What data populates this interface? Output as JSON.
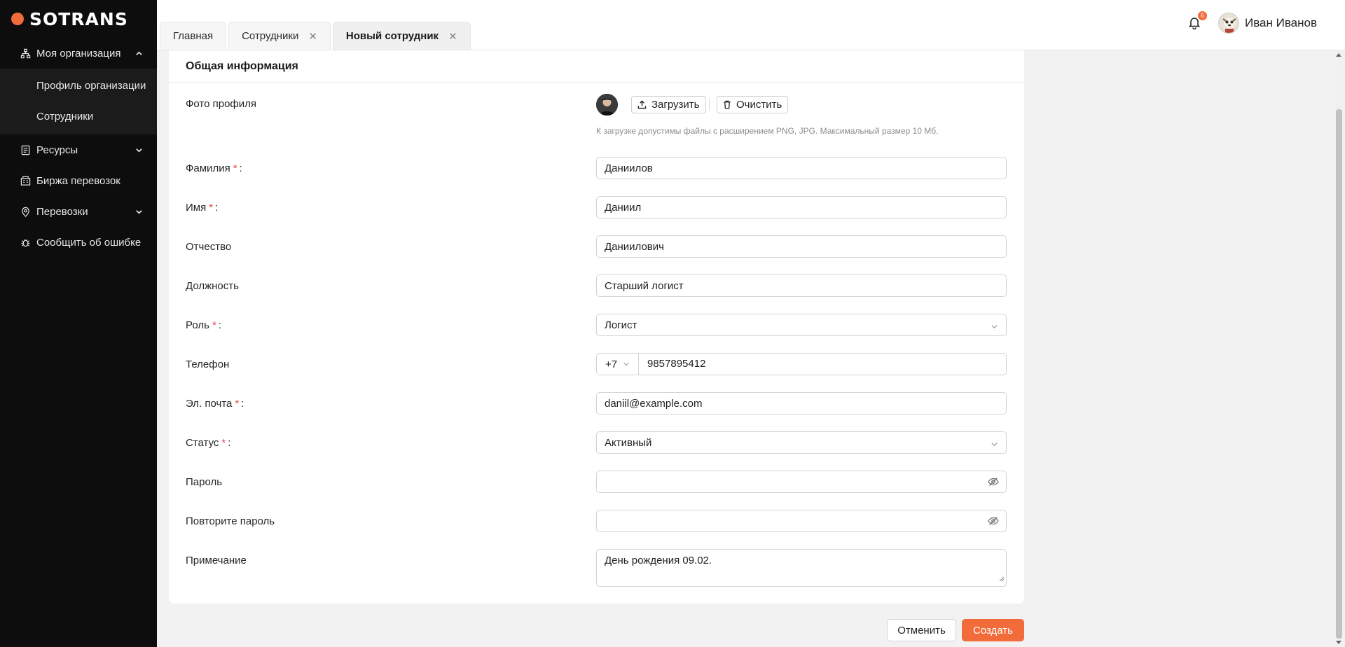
{
  "brand": {
    "name": "SOTRANS",
    "accent": "#f26b3a"
  },
  "sidebar": {
    "items": [
      {
        "label": "Моя организация",
        "icon": "org-structure-icon",
        "expanded": true,
        "children": [
          {
            "label": "Профиль организации"
          },
          {
            "label": "Сотрудники"
          }
        ]
      },
      {
        "label": "Ресурсы",
        "icon": "resources-icon",
        "expanded": false
      },
      {
        "label": "Биржа перевозок",
        "icon": "exchange-icon"
      },
      {
        "label": "Перевозки",
        "icon": "location-pin-icon",
        "expanded": false
      },
      {
        "label": "Сообщить об ошибке",
        "icon": "bug-icon"
      }
    ]
  },
  "tabs": [
    {
      "label": "Главная",
      "closable": false
    },
    {
      "label": "Сотрудники",
      "closable": true
    },
    {
      "label": "Новый сотрудник",
      "closable": true,
      "active": true
    }
  ],
  "header": {
    "notifications_count": "6",
    "user_name": "Иван Иванов"
  },
  "form": {
    "section_title": "Общая информация",
    "photo": {
      "label": "Фото профиля",
      "upload_label": "Загрузить",
      "clear_label": "Очистить",
      "hint": "К загрузке допустимы файлы с расширением PNG, JPG. Максимальный размер 10 Мб."
    },
    "last_name": {
      "label": "Фамилия",
      "value": "Даниилов",
      "required": true
    },
    "first_name": {
      "label": "Имя",
      "value": "Даниил",
      "required": true
    },
    "patronymic": {
      "label": "Отчество",
      "value": "Даниилович"
    },
    "position": {
      "label": "Должность",
      "value": "Старший логист"
    },
    "role": {
      "label": "Роль",
      "value": "Логист",
      "required": true
    },
    "phone": {
      "label": "Телефон",
      "code": "+7",
      "value": "9857895412"
    },
    "email": {
      "label": "Эл. почта",
      "value": "daniil@example.com",
      "required": true
    },
    "status": {
      "label": "Статус",
      "value": "Активный",
      "required": true
    },
    "password": {
      "label": "Пароль",
      "value": ""
    },
    "password_repeat": {
      "label": "Повторите пароль",
      "value": ""
    },
    "note": {
      "label": "Примечание",
      "value": "День рождения 09.02."
    },
    "required_mark": "*",
    "colon": ":"
  },
  "actions": {
    "cancel_label": "Отменить",
    "create_label": "Создать"
  }
}
